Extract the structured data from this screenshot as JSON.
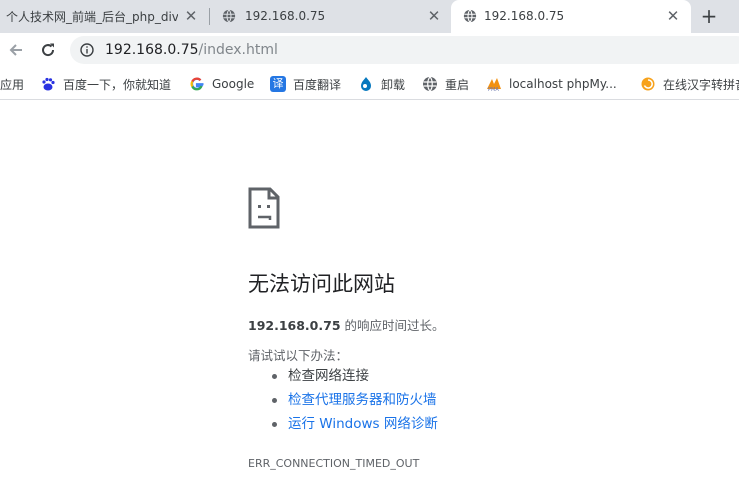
{
  "tabs": [
    {
      "title": "个人技术网_前端_后台_php_div_"
    },
    {
      "title": "192.168.0.75"
    },
    {
      "title": "192.168.0.75"
    }
  ],
  "toolbar": {
    "url_host": "192.168.0.75",
    "url_path": "/index.html"
  },
  "bookmarks": [
    {
      "label": "应用",
      "icon": "apps-icon"
    },
    {
      "label": "百度一下，你就知道",
      "icon": "baidu-paw-icon"
    },
    {
      "label": "Google",
      "icon": "google-g-icon"
    },
    {
      "label": "百度翻译",
      "icon": "baidu-translate-icon"
    },
    {
      "label": "卸载",
      "icon": "drupal-drop-icon"
    },
    {
      "label": "重启",
      "icon": "globe-icon"
    },
    {
      "label": "localhost phpMy...",
      "icon": "phpmyadmin-icon"
    },
    {
      "label": "在线汉字转拼音",
      "icon": "pinyin-swirl-icon"
    }
  ],
  "error": {
    "title": "无法访问此网站",
    "host": "192.168.0.75",
    "desc_suffix": " 的响应时间过长。",
    "try_heading": "请试试以下办法：",
    "suggestions": [
      {
        "text": "检查网络连接",
        "is_link": false
      },
      {
        "text": "检查代理服务器和防火墙",
        "is_link": true
      },
      {
        "text": "运行 Windows 网络诊断",
        "is_link": true
      }
    ],
    "code": "ERR_CONNECTION_TIMED_OUT"
  },
  "colors": {
    "tabstrip": "#dee1e6",
    "link": "#1a73e8",
    "text": "#202124",
    "muted": "#5f6368"
  }
}
